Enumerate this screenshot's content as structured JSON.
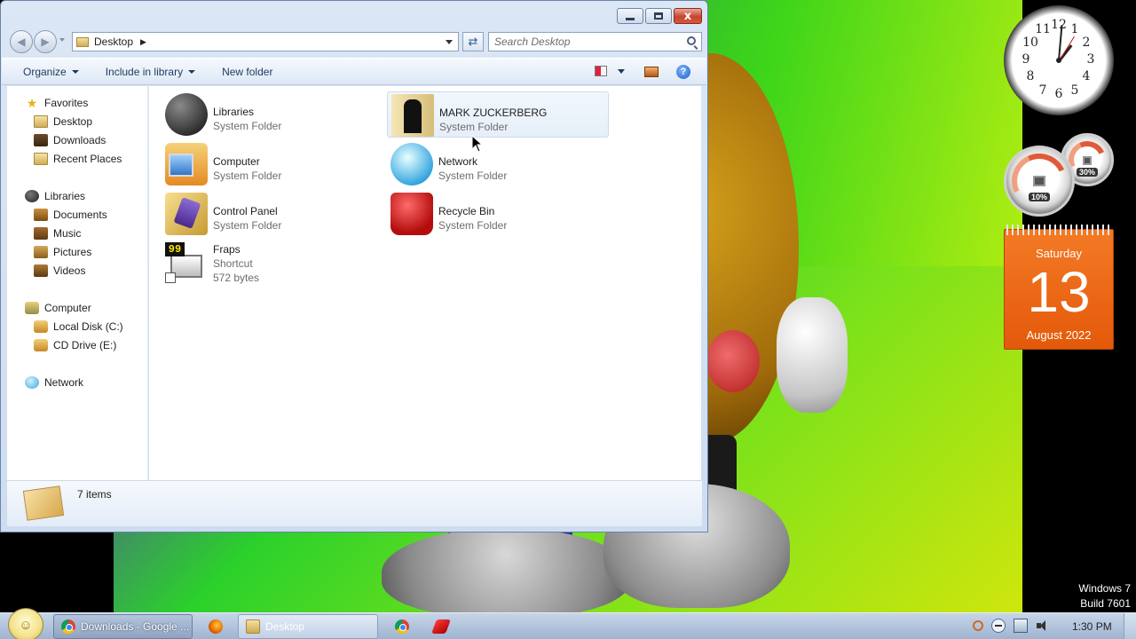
{
  "window": {
    "address_crumb": "Desktop",
    "search_placeholder": "Search Desktop",
    "caption_minimize": "–",
    "caption_maximize": "□",
    "caption_close": "x"
  },
  "toolbar": {
    "organize": "Organize",
    "include_in_library": "Include in library",
    "new_folder": "New folder"
  },
  "navpane": {
    "favorites": "Favorites",
    "desktop": "Desktop",
    "downloads": "Downloads",
    "recent_places": "Recent Places",
    "libraries": "Libraries",
    "documents": "Documents",
    "music": "Music",
    "pictures": "Pictures",
    "videos": "Videos",
    "computer": "Computer",
    "local_disk": "Local Disk (C:)",
    "cd_drive": "CD Drive (E:)",
    "network": "Network"
  },
  "items": [
    {
      "title": "Libraries",
      "sub": "System Folder",
      "icon": "libraries-icon"
    },
    {
      "title": "MARK ZUCKERBERG",
      "sub": "System Folder",
      "icon": "user-folder-icon"
    },
    {
      "title": "Computer",
      "sub": "System Folder",
      "icon": "computer-icon"
    },
    {
      "title": "Network",
      "sub": "System Folder",
      "icon": "network-icon"
    },
    {
      "title": "Control Panel",
      "sub": "System Folder",
      "icon": "control-panel-icon"
    },
    {
      "title": "Recycle Bin",
      "sub": "System Folder",
      "icon": "recycle-bin-icon"
    },
    {
      "title": "Fraps",
      "sub": "Shortcut",
      "sub2": "572 bytes",
      "icon": "fraps-icon"
    }
  ],
  "details": {
    "count": "7 items"
  },
  "gadgets": {
    "clock_numbers": [
      "12",
      "1",
      "2",
      "3",
      "4",
      "5",
      "6",
      "7",
      "8",
      "9",
      "10",
      "11"
    ],
    "cpu_value": "10%",
    "mem_value": "30%",
    "calendar_day": "Saturday",
    "calendar_date": "13",
    "calendar_month": "August 2022"
  },
  "watermark": {
    "line1": "Windows 7",
    "line2": "Build 7601"
  },
  "taskbar": {
    "chrome_label": "Downloads - Google ...",
    "explorer_label": "Desktop",
    "time": "1:30 PM"
  }
}
